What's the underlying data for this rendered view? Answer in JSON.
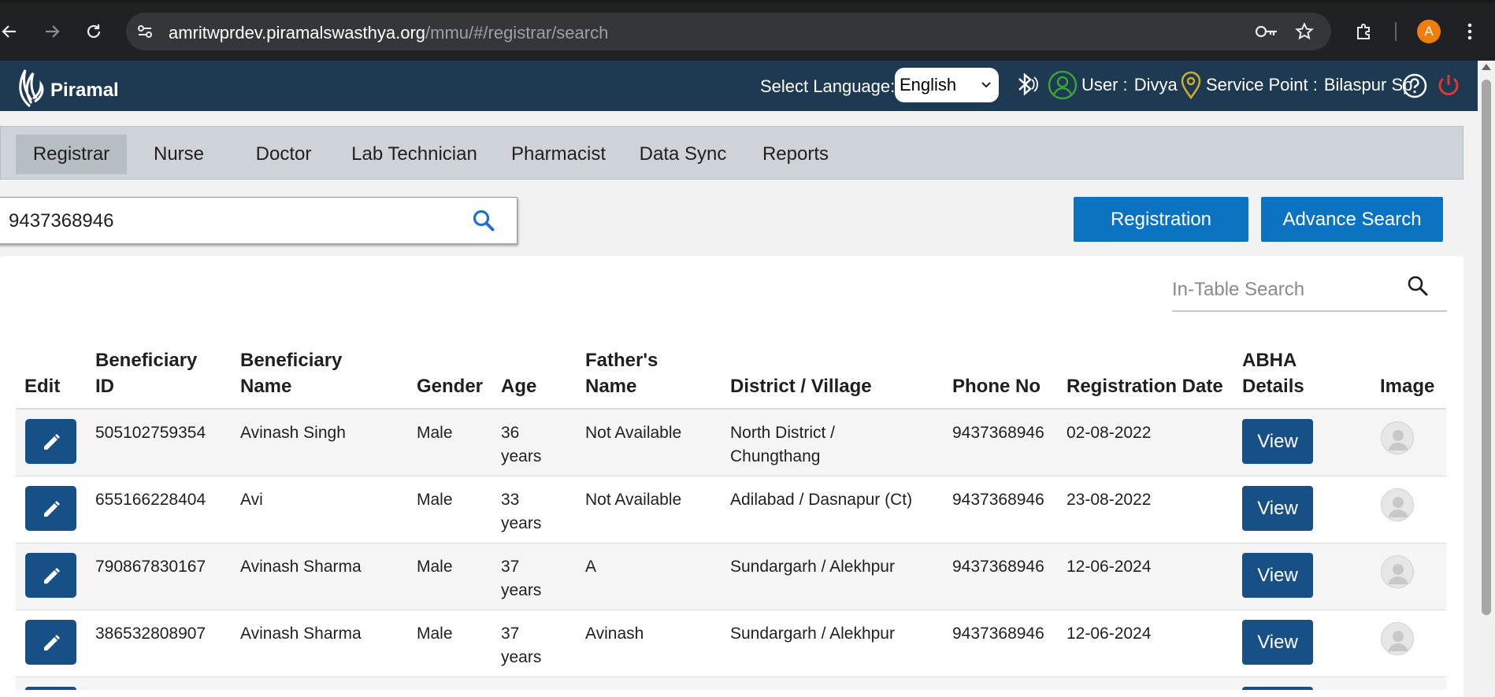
{
  "browser": {
    "url_host": "amritwprdev.piramalswasthya.org",
    "url_path": "/mmu/#/registrar/search",
    "profile_initial": "A"
  },
  "header": {
    "brand": "Piramal",
    "language_label": "Select Language:",
    "language_value": "English",
    "user_label": "User :",
    "user_name": "Divya",
    "service_point_label": "Service Point :",
    "service_point_value": "Bilaspur Sp"
  },
  "roles": [
    {
      "label": "Registrar",
      "active": true
    },
    {
      "label": "Nurse",
      "active": false
    },
    {
      "label": "Doctor",
      "active": false
    },
    {
      "label": "Lab Technician",
      "active": false
    },
    {
      "label": "Pharmacist",
      "active": false
    },
    {
      "label": "Data Sync",
      "active": false
    },
    {
      "label": "Reports",
      "active": false
    }
  ],
  "search": {
    "value": "9437368946"
  },
  "actions": {
    "registration": "Registration",
    "advance_search": "Advance Search"
  },
  "in_table_search": {
    "placeholder": "In-Table Search"
  },
  "table": {
    "headers": {
      "edit": "Edit",
      "ben_id_1": "Beneficiary",
      "ben_id_2": "ID",
      "ben_name_1": "Beneficiary",
      "ben_name_2": "Name",
      "gender": "Gender",
      "age": "Age",
      "father_1": "Father's",
      "father_2": "Name",
      "district": "District / Village",
      "phone": "Phone No",
      "reg_date": "Registration Date",
      "abha_1": "ABHA",
      "abha_2": "Details",
      "image": "Image"
    },
    "view_label": "View",
    "rows": [
      {
        "id": "505102759354",
        "name": "Avinash Singh",
        "gender": "Male",
        "age_1": "36",
        "age_2": "years",
        "father": "Not Available",
        "district_1": "North District /",
        "district_2": "Chungthang",
        "phone": "9437368946",
        "date": "02-08-2022"
      },
      {
        "id": "655166228404",
        "name": "Avi",
        "gender": "Male",
        "age_1": "33",
        "age_2": "years",
        "father": "Not Available",
        "district_1": "Adilabad / Dasnapur (Ct)",
        "district_2": "",
        "phone": "9437368946",
        "date": "23-08-2022"
      },
      {
        "id": "790867830167",
        "name": "Avinash Sharma",
        "gender": "Male",
        "age_1": "37",
        "age_2": "years",
        "father": "A",
        "district_1": "Sundargarh / Alekhpur",
        "district_2": "",
        "phone": "9437368946",
        "date": "12-06-2024"
      },
      {
        "id": "386532808907",
        "name": "Avinash Sharma",
        "gender": "Male",
        "age_1": "37",
        "age_2": "years",
        "father": "Avinash",
        "district_1": "Sundargarh / Alekhpur",
        "district_2": "",
        "phone": "9437368946",
        "date": "12-06-2024"
      }
    ]
  }
}
